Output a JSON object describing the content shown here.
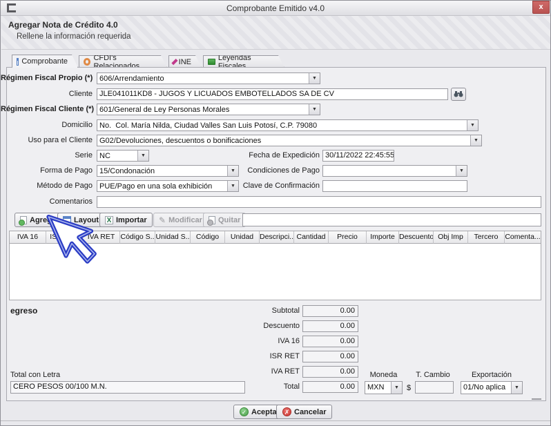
{
  "window": {
    "title": "Comprobante Emitido v4.0",
    "close": "x"
  },
  "header": {
    "title": "Agregar Nota de Crédito 4.0",
    "subtitle": "Rellene la información requerida"
  },
  "tabs": [
    {
      "label": "Comprobante"
    },
    {
      "label": "CFDI's Relacionados"
    },
    {
      "label": "INE"
    },
    {
      "label": "Leyendas Fiscales"
    }
  ],
  "form": {
    "regimen_propio": {
      "label": "Régimen Fiscal Propio (*)",
      "value": "606/Arrendamiento"
    },
    "cliente": {
      "label": "Cliente",
      "value": "JLE041011KD8 - JUGOS Y LICUADOS EMBOTELLADOS SA DE CV"
    },
    "regimen_cliente": {
      "label": "Régimen Fiscal Cliente (*)",
      "value": "601/General de Ley Personas Morales"
    },
    "domicilio": {
      "label": "Domicilio",
      "value": "No.  Col. María Nilda, Ciudad Valles San Luis Potosí, C.P. 79080"
    },
    "uso_cliente": {
      "label": "Uso para el Cliente",
      "value": "G02/Devoluciones, descuentos o bonificaciones"
    },
    "serie": {
      "label": "Serie",
      "value": "NC"
    },
    "fecha_expedicion": {
      "label": "Fecha de Expedición",
      "value": "30/11/2022 22:45:55"
    },
    "forma_pago": {
      "label": "Forma de Pago",
      "value": "15/Condonación"
    },
    "condiciones_pago": {
      "label": "Condiciones de Pago",
      "value": ""
    },
    "metodo_pago": {
      "label": "Método de Pago",
      "value": "PUE/Pago en una sola exhibición"
    },
    "clave_confirmacion": {
      "label": "Clave de Confirmación",
      "value": ""
    },
    "comentarios": {
      "label": "Comentarios",
      "value": ""
    }
  },
  "toolbar": {
    "agregar": "Agregar",
    "layout": "Layout",
    "importar": "Importar",
    "modificar": "Modificar",
    "quitar": "Quitar",
    "search_value": "",
    "excel_letter": "X"
  },
  "table": {
    "columns": [
      "IVA 16",
      "ISR RET",
      "IVA RET",
      "Código S..",
      "Unidad S..",
      "Código",
      "Unidad",
      "Descripci...",
      "Cantidad",
      "Precio",
      "Importe",
      "Descuento",
      "Obj Imp",
      "Tercero",
      "Comenta..."
    ],
    "rows": []
  },
  "summary": {
    "tipo": "egreso",
    "rows": [
      {
        "label": "Subtotal",
        "value": "0.00"
      },
      {
        "label": "Descuento",
        "value": "0.00"
      },
      {
        "label": "IVA 16",
        "value": "0.00"
      },
      {
        "label": "ISR RET",
        "value": "0.00"
      },
      {
        "label": "IVA RET",
        "value": "0.00"
      },
      {
        "label": "Total",
        "value": "0.00"
      }
    ],
    "total_con_letra": {
      "label": "Total con Letra",
      "value": "CERO PESOS 00/100 M.N."
    },
    "moneda": {
      "label": "Moneda",
      "value": "MXN"
    },
    "t_cambio": {
      "label": "T. Cambio",
      "prefix": "$",
      "value": ""
    },
    "exportacion": {
      "label": "Exportación",
      "value": "01/No aplica"
    }
  },
  "footer": {
    "aceptar": "Aceptar",
    "cancelar": "Cancelar"
  },
  "colors": {
    "accent_red": "#bf5a58",
    "excel_green": "#217346",
    "ok_green": "#4da04d",
    "cancel_red": "#cc3b36",
    "cursor_blue": "#2b3cc4"
  }
}
